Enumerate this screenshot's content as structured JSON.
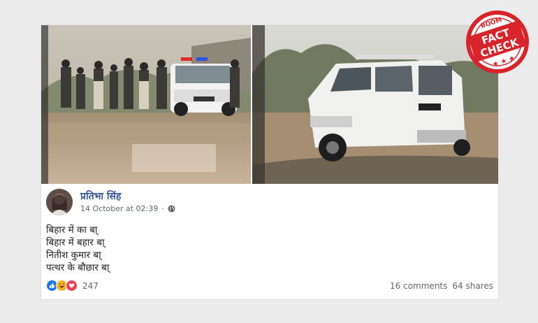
{
  "post": {
    "author_name": "प्रतिभा सिंह",
    "timestamp": "14 October at 02:39",
    "privacy_icon": "globe-icon",
    "lines": [
      "बिहार में का बा्",
      "बिहार में बहार बा्",
      "नितीश कुमार बा्",
      "पत्थर के बौछार बा्"
    ]
  },
  "footer": {
    "reaction_count": "247",
    "reaction_icons": [
      "like-icon",
      "haha-icon",
      "love-icon"
    ],
    "comments_label": "16 comments",
    "shares_label": "64 shares"
  },
  "badge": {
    "top_text": "BOOM",
    "line1": "FACT",
    "line2": "CHECK",
    "color": "#d8232a"
  },
  "colors": {
    "author_link": "#385898",
    "secondary_text": "#606770",
    "like_blue": "#1877f2",
    "love_red": "#f33e58",
    "haha_yellow": "#f7b125"
  }
}
